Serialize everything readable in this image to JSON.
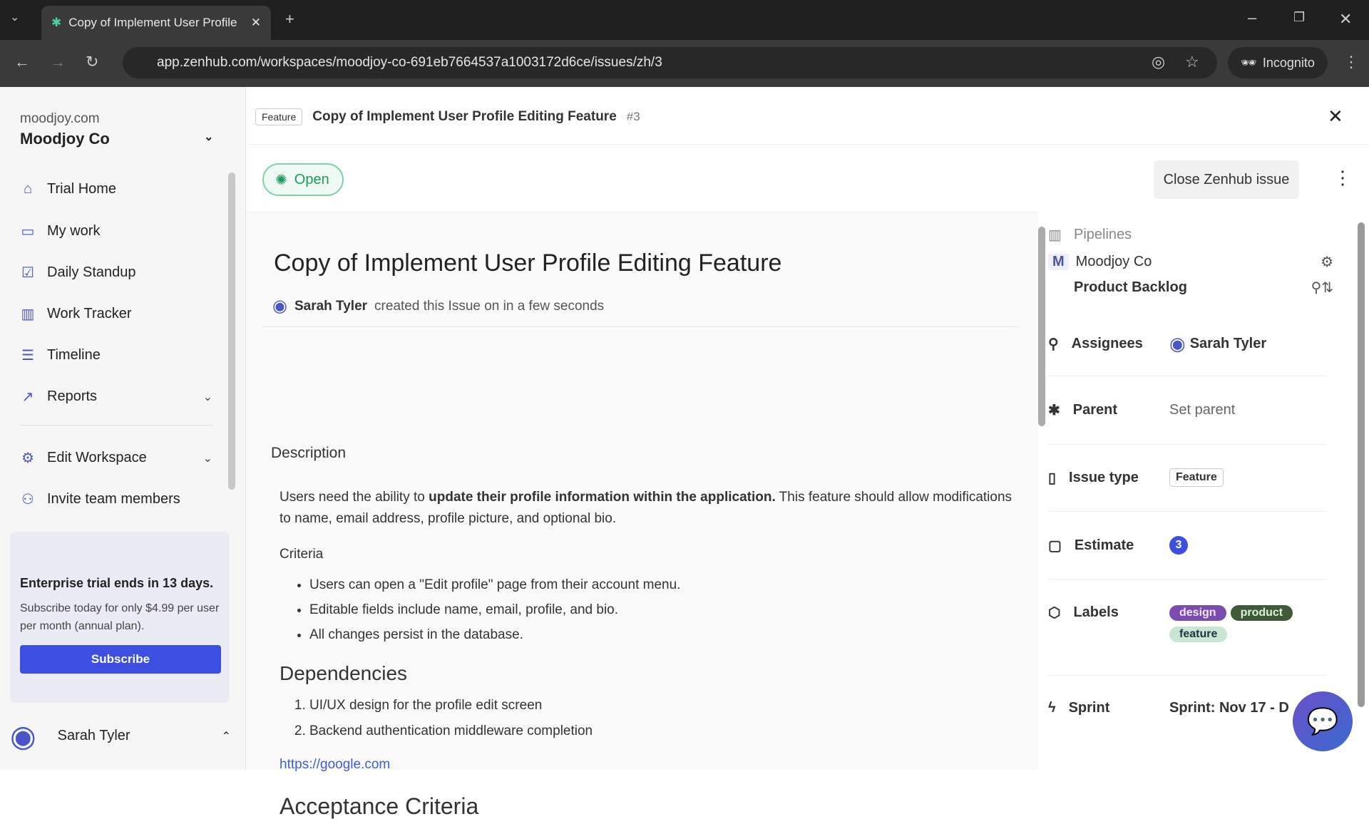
{
  "browser": {
    "tab_title": "Copy of Implement User Profile",
    "url": "app.zenhub.com/workspaces/moodjoy-co-691eb7664537a1003172d6ce/issues/zh/3",
    "incognito": "Incognito"
  },
  "sidebar": {
    "domain": "moodjoy.com",
    "workspace": "Moodjoy Co",
    "items": [
      {
        "label": "Trial Home",
        "icon": "home-icon"
      },
      {
        "label": "My work",
        "icon": "inbox-icon"
      },
      {
        "label": "Daily Standup",
        "icon": "calendar-check-icon"
      },
      {
        "label": "Work Tracker",
        "icon": "columns-icon"
      },
      {
        "label": "Timeline",
        "icon": "timeline-icon"
      },
      {
        "label": "Reports",
        "icon": "chart-icon"
      },
      {
        "label": "Edit Workspace",
        "icon": "gear-icon"
      },
      {
        "label": "Invite team members",
        "icon": "add-user-icon"
      }
    ],
    "trial": {
      "title": "Enterprise trial ends in 13 days.",
      "text": "Subscribe today for only $4.99 per user per month (annual plan).",
      "button": "Subscribe"
    },
    "user": "Sarah Tyler"
  },
  "issue": {
    "type_pill": "Feature",
    "header_title": "Copy of Implement User Profile Editing Feature",
    "number": "#3",
    "status": "Open",
    "close_button": "Close Zenhub issue",
    "title": "Copy of Implement User Profile Editing Feature",
    "author": "Sarah Tyler",
    "created": "created this Issue on in a few seconds",
    "description_heading": "Description",
    "desc_pre": "Users need the ability to ",
    "desc_bold": "update their profile information within the application.",
    "desc_post": " This feature should allow modifications to name, email address, profile picture, and optional bio.",
    "criteria_label": "Criteria",
    "criteria": [
      "Users can open a \"Edit profile\" page from their account menu.",
      "Editable fields include name, email, profile, and bio.",
      "All changes persist in the database."
    ],
    "dependencies_heading": "Dependencies",
    "dependencies": [
      "UI/UX design for the profile edit screen",
      "Backend authentication middleware completion"
    ],
    "link": "https://google.com",
    "acceptance_heading": "Acceptance Criteria"
  },
  "panel": {
    "pipelines_label": "Pipelines",
    "workspace_initial": "M",
    "workspace": "Moodjoy Co",
    "pipeline": "Product Backlog",
    "assignees_label": "Assignees",
    "assignee": "Sarah Tyler",
    "parent_label": "Parent",
    "parent_value": "Set parent",
    "issue_type_label": "Issue type",
    "issue_type": "Feature",
    "estimate_label": "Estimate",
    "estimate": "3",
    "labels_label": "Labels",
    "labels": [
      {
        "name": "design",
        "color": "#7b4bb0"
      },
      {
        "name": "product",
        "color": "#3f5a36"
      },
      {
        "name": "feature",
        "color": "#c9e6d2"
      }
    ],
    "sprint_label": "Sprint",
    "sprint": "Sprint: Nov 17 - D"
  }
}
